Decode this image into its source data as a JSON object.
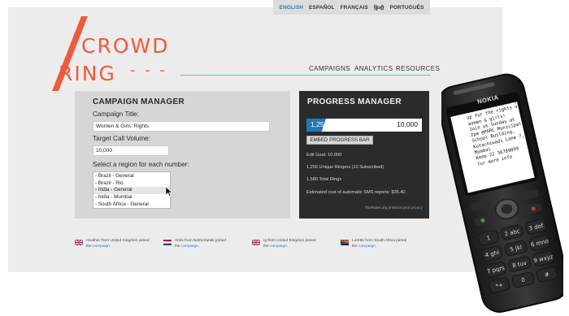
{
  "languages": [
    "ENGLISH",
    "ESPAÑOL",
    "FRANÇAIS",
    "हिन्दी",
    "PORTUGUÊS"
  ],
  "brand": {
    "line1": "CROWD",
    "line2": "RING",
    "dashes": "- - -",
    "color": "#f05a3c"
  },
  "nav": {
    "campaigns": "CAMPAIGNS",
    "analytics": "ANALYTICS",
    "resources": "RESOURCES"
  },
  "campaign_manager": {
    "title": "CAMPAIGN MANAGER",
    "campaign_title_label": "Campaign Title:",
    "campaign_title_value": "Women & Girls' Rights",
    "target_label": "Target Call Volume:",
    "target_value": "10,000",
    "region_label": "Select a region for each number:",
    "regions": [
      "- Brazil - General",
      "- Brazil - Rio",
      "- India - General",
      "- India - Mumbai",
      "- South Africa - General"
    ],
    "selected_region": "- India - General"
  },
  "progress_manager": {
    "title": "PROGRESS MANAGER",
    "current": "1,259",
    "goal": "10,000",
    "progress_fraction": 0.1259,
    "embed_label": "EMBED PROGRESS BAR",
    "stats": [
      "Edit Goal: 10,000",
      "1,259 Unique Ringers (10 Subscribed)",
      "1,580 Total Rings",
      "Estimated cost of automatic SMS reports: $35.40"
    ],
    "footer_prefix": "TheRules.org protects your ",
    "footer_link": "privacy",
    "accent": "#1f79b8"
  },
  "feed": [
    {
      "name": "Heather from United Kingdom joined",
      "prefix": "the ",
      "link": "campaign.",
      "flag": "uk-flag"
    },
    {
      "name": "Amis from Netherlands joined",
      "prefix": "the ",
      "link": "campaign.",
      "flag": "netherlands-flag"
    },
    {
      "name": "Ig from United Kingdom joined",
      "prefix": "the ",
      "link": "campaign.",
      "flag": "uk-flag"
    },
    {
      "name": "Lorette from South Africa joined",
      "prefix": "the ",
      "link": "campaign.",
      "flag": "south-africa-flag"
    }
  ],
  "phone": {
    "brand": "NOKIA",
    "sms": "Thanks for standing\nup for the rights of\nwomen & girls!\nJoin us Sunday at\n2pm @PARC Municipal\nSchool Building,\nKotachiwadi Lane 7,\nMumbai\nKeep 22 36789099\nfor more info"
  }
}
